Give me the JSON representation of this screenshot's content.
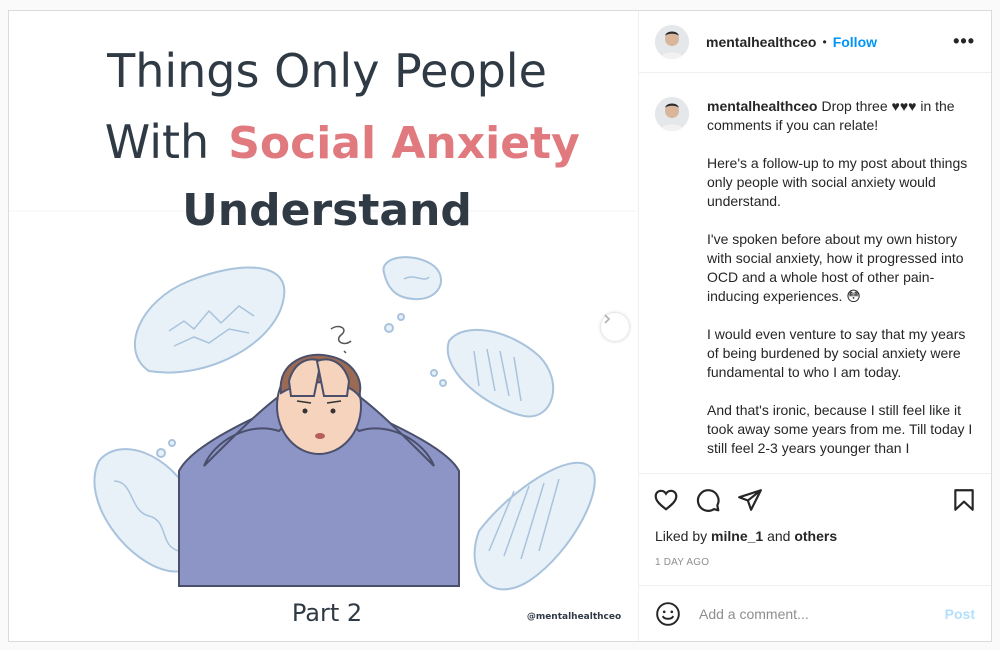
{
  "image": {
    "title_line1": "Things Only People",
    "title_line2_a": "With",
    "title_line2_b": "Social Anxiety",
    "title_line3": "Understand",
    "part": "Part 2",
    "watermark": "@mentalhealthceo",
    "colors": {
      "accent": "#e07a7f",
      "dark": "#2f3a45",
      "bubble": "#e9f1f8",
      "shirt": "#8d95c6"
    }
  },
  "header": {
    "username": "mentalhealthceo",
    "separator": "•",
    "follow_label": "Follow",
    "more_label": "•••"
  },
  "caption": {
    "username": "mentalhealthceo",
    "paragraphs": [
      "Drop three ♥♥♥ in the comments if you can relate!",
      "Here's a follow-up to my post about things only people with social anxiety would understand.",
      "I've spoken before about my own history with social anxiety, how it progressed into OCD and a whole host of other pain-inducing experiences. 😳",
      "I would even venture to say that my years of being burdened by social anxiety were fundamental to who I am today.",
      "And that's ironic, because I still feel like it took away some years from me. Till today I still feel 2-3 years younger than I"
    ]
  },
  "likes": {
    "prefix": "Liked by",
    "user": "milne_1",
    "and": "and",
    "others": "others"
  },
  "timestamp": "1 DAY AGO",
  "comment_box": {
    "placeholder": "Add a comment...",
    "post_label": "Post"
  },
  "icons": [
    "next-arrow-icon",
    "heart-icon",
    "comment-icon",
    "share-icon",
    "bookmark-icon",
    "emoji-icon"
  ]
}
